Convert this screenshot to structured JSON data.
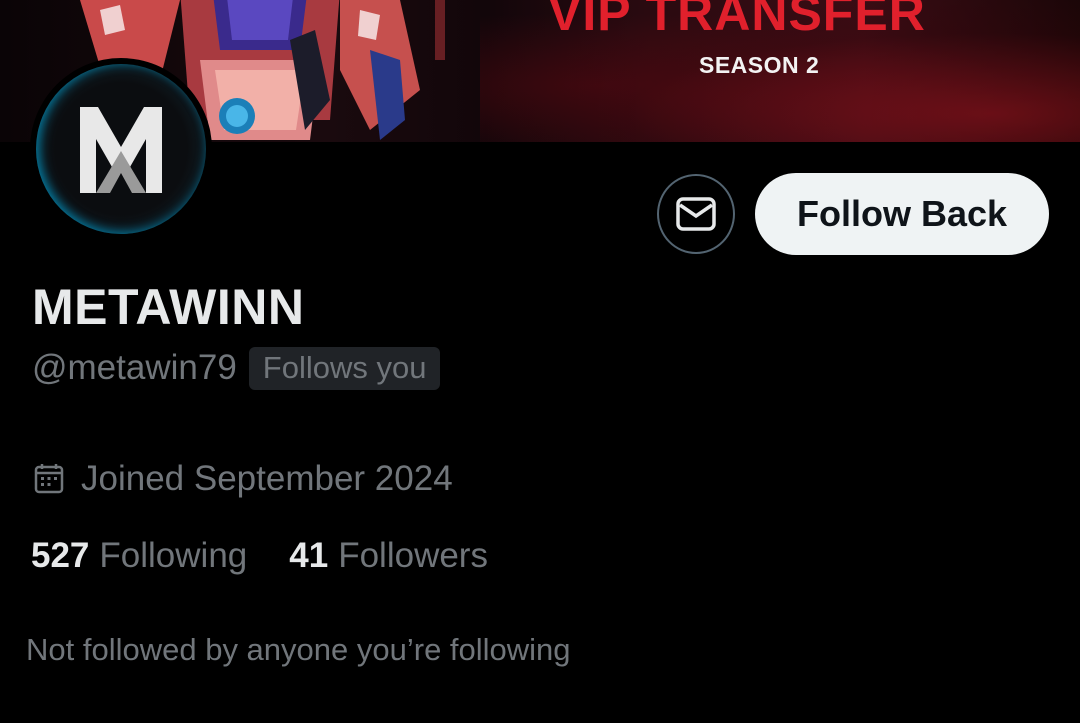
{
  "banner": {
    "title": "VIP TRANSFER",
    "subtitle": "SEASON 2"
  },
  "profile": {
    "name": "METAWINN",
    "handle": "@metawin79",
    "follows_you_badge": "Follows you",
    "joined": "Joined September 2024",
    "following_count": "527",
    "following_label": "Following",
    "followers_count": "41",
    "followers_label": "Followers",
    "mutuals_note": "Not followed by anyone you’re following"
  },
  "actions": {
    "follow_back_label": "Follow Back",
    "message_icon": "envelope-icon"
  },
  "colors": {
    "background": "#000000",
    "primary_text": "#e7e9ea",
    "secondary_text": "#71767b",
    "button_bg": "#eff3f4",
    "banner_accent": "#e1202c"
  }
}
